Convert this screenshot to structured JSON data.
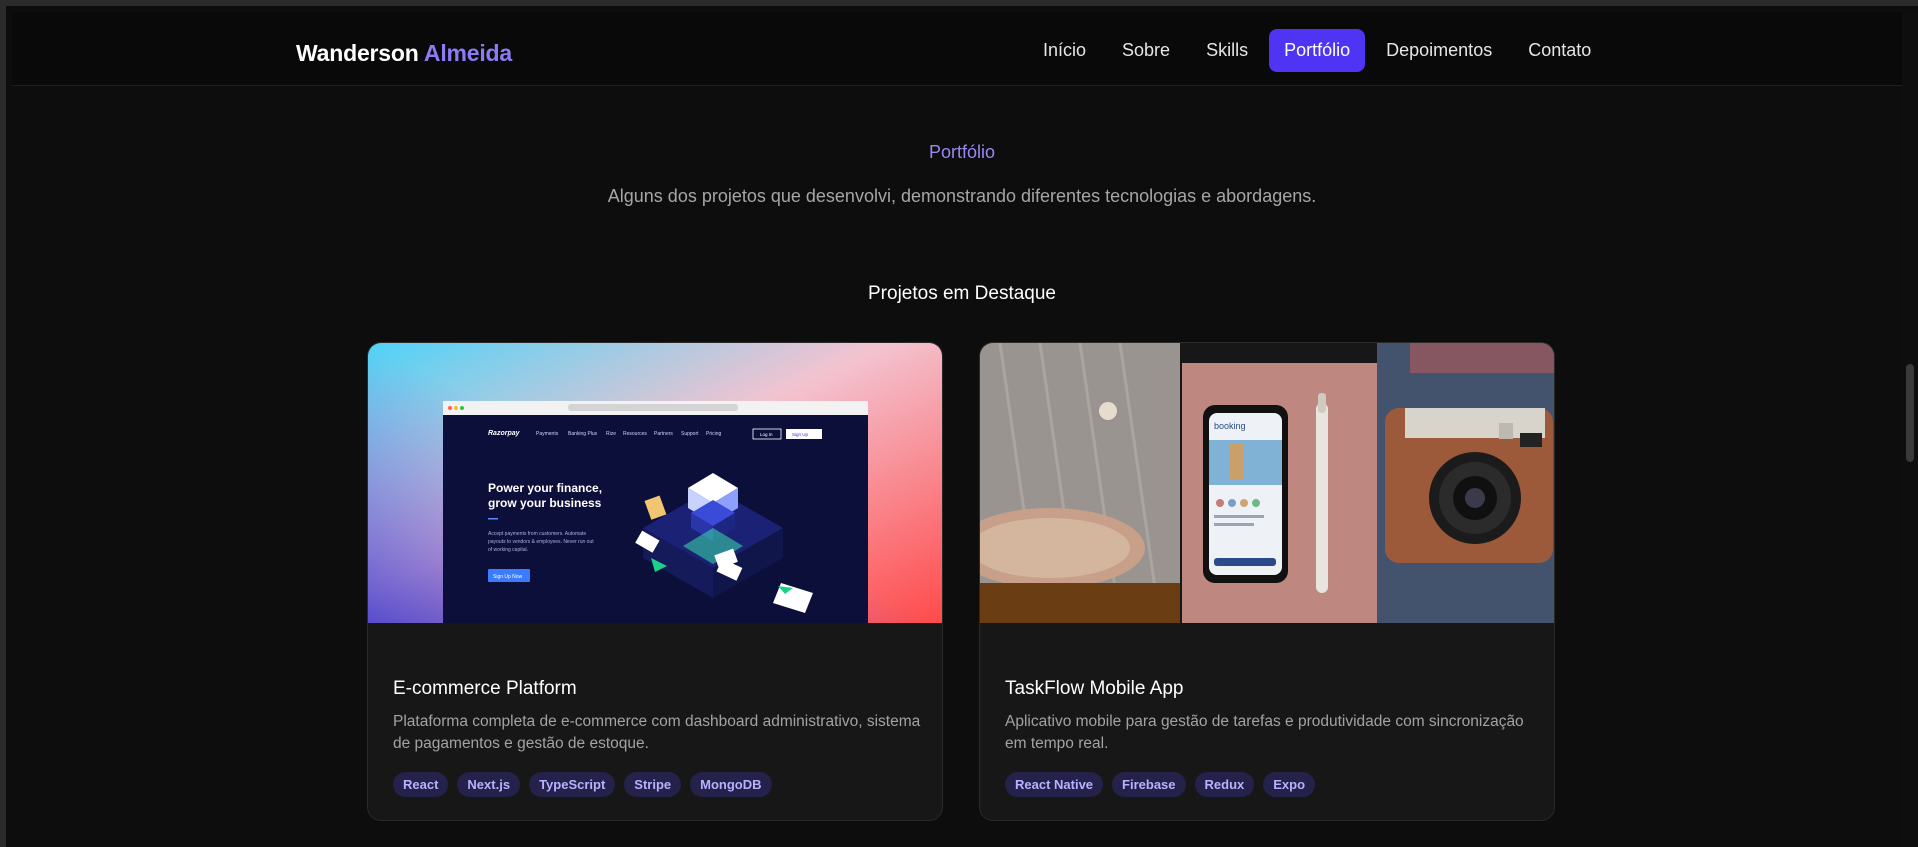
{
  "header": {
    "brand_first": "Wanderson",
    "brand_last": "Almeida",
    "nav": [
      {
        "label": "Início",
        "active": false
      },
      {
        "label": "Sobre",
        "active": false
      },
      {
        "label": "Skills",
        "active": false
      },
      {
        "label": "Portfólio",
        "active": true
      },
      {
        "label": "Depoimentos",
        "active": false
      },
      {
        "label": "Contato",
        "active": false
      }
    ]
  },
  "section": {
    "label": "Portfólio",
    "subtitle": "Alguns dos projetos que desenvolvi, demonstrando diferentes tecnologias e abordagens.",
    "featured_title": "Projetos em Destaque"
  },
  "projects": [
    {
      "title": "E-commerce Platform",
      "description": "Plataforma completa de e-commerce com dashboard administrativo, sistema de pagamentos e gestão de estoque.",
      "tags": [
        "React",
        "Next.js",
        "TypeScript",
        "Stripe",
        "MongoDB"
      ],
      "screenshot": {
        "logo": "Razorpay",
        "menu": [
          "Payments",
          "Banking Plus",
          "Rize",
          "Resources",
          "Partners",
          "Support",
          "Pricing"
        ],
        "login": "Log In",
        "signup": "Sign Up",
        "headline_1": "Power your finance,",
        "headline_2": "grow your business",
        "body_1": "Accept payments from customers. Automate",
        "body_2": "payouts to vendors & employees. Never run out",
        "body_3": "of working capital.",
        "cta": "Sign Up Now"
      }
    },
    {
      "title": "TaskFlow Mobile App",
      "description": "Aplicativo mobile para gestão de tarefas e produtividade com sincronização em tempo real.",
      "tags": [
        "React Native",
        "Firebase",
        "Redux",
        "Expo"
      ],
      "screenshot": {
        "app_name": "booking"
      }
    }
  ],
  "colors": {
    "accent": "#4f35f3",
    "accent_text": "#8b7cf6",
    "background": "#0d0d0d",
    "card": "#171717"
  }
}
